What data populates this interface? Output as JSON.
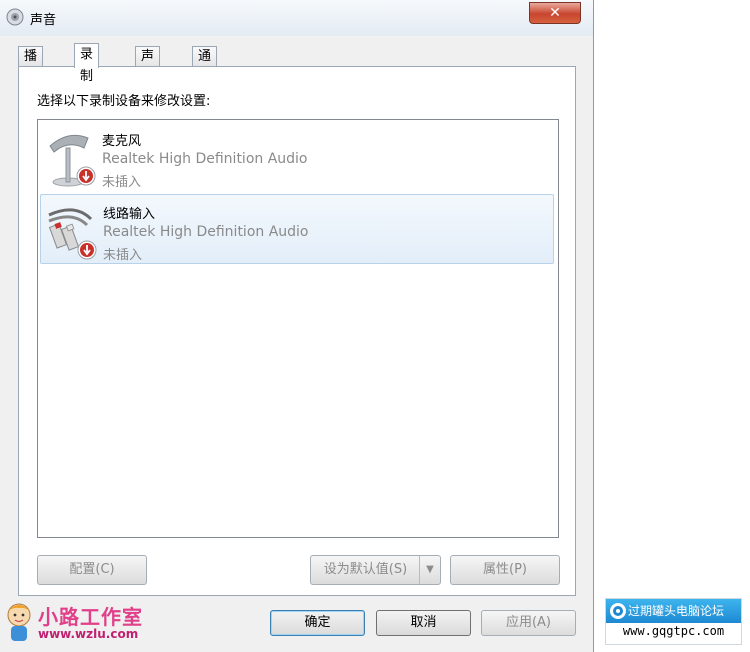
{
  "window": {
    "title": "声音",
    "close_label": "✕"
  },
  "tabs": [
    {
      "label": "播放"
    },
    {
      "label": "录制"
    },
    {
      "label": "声音"
    },
    {
      "label": "通信"
    }
  ],
  "panel": {
    "instruction": "选择以下录制设备来修改设置:"
  },
  "devices": [
    {
      "name": "麦克风",
      "description": "Realtek High Definition Audio",
      "status": "未插入",
      "icon": "microphone-icon",
      "selected": false
    },
    {
      "name": "线路输入",
      "description": "Realtek High Definition Audio",
      "status": "未插入",
      "icon": "line-in-cable-icon",
      "selected": true
    }
  ],
  "buttons": {
    "configure": "配置(C)",
    "set_default": "设为默认值(S)",
    "properties": "属性(P)",
    "ok": "确定",
    "cancel": "取消",
    "apply": "应用(A)"
  },
  "watermarks": {
    "left_main": "小路工作室",
    "left_url": "www.wzlu.com",
    "right_top": "过期罐头电脑论坛",
    "right_url": "www.gqgtpc.com"
  },
  "colors": {
    "close_button": "#c8452f",
    "selection": "#e3eef9",
    "disabled_text": "#8c8c8c"
  }
}
